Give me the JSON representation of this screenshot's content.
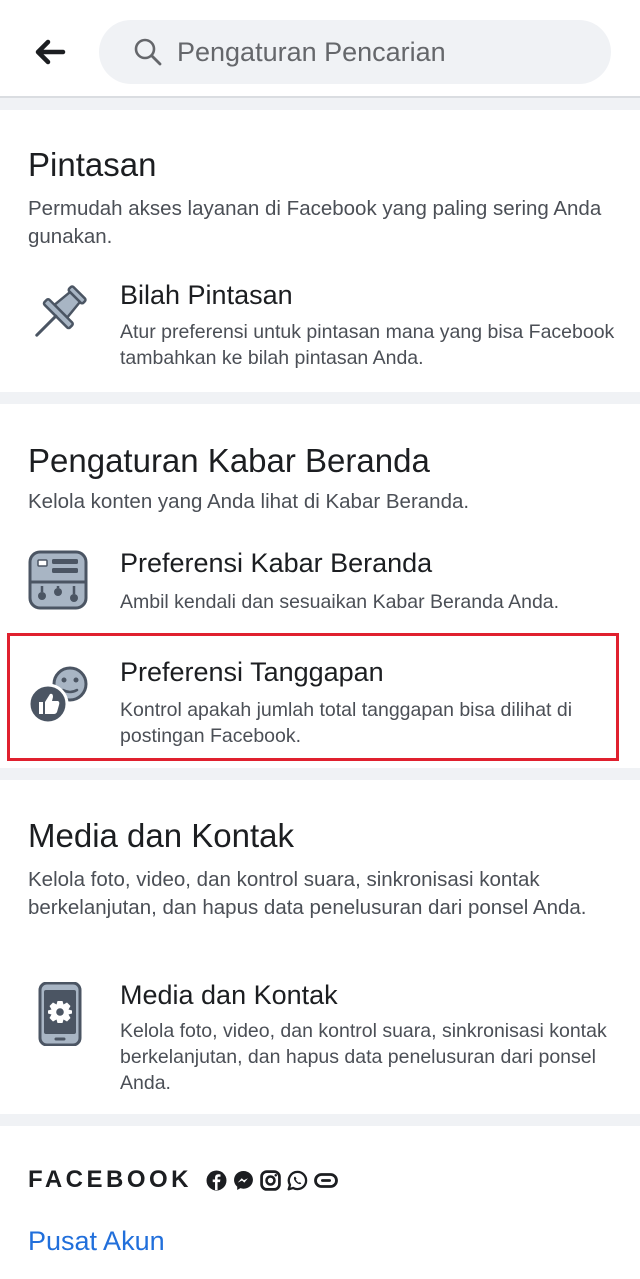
{
  "header": {
    "search_placeholder": "Pengaturan Pencarian",
    "back_icon": "arrow-left-icon",
    "search_icon": "magnifier-icon"
  },
  "sections": {
    "shortcuts": {
      "title": "Pintasan",
      "description": "Permudah akses layanan di Facebook yang paling sering Anda gunakan.",
      "items": [
        {
          "icon": "pushpin-icon",
          "title": "Bilah Pintasan",
          "description": "Atur preferensi untuk pintasan mana yang bisa Facebook tambahkan ke bilah pintasan Anda."
        }
      ]
    },
    "news_feed": {
      "title": "Pengaturan Kabar Beranda",
      "description": "Kelola konten yang Anda lihat di Kabar Beranda.",
      "items": [
        {
          "icon": "news-feed-preferences-icon",
          "title": "Preferensi Kabar Beranda",
          "description": "Ambil kendali dan sesuaikan Kabar Beranda Anda."
        },
        {
          "icon": "reactions-icon",
          "title": "Preferensi Tanggapan",
          "description": "Kontrol apakah jumlah total tanggapan bisa dilihat di postingan Facebook."
        }
      ]
    },
    "media": {
      "title": "Media dan Kontak",
      "description": "Kelola foto, video, dan kontrol suara, sinkronisasi kontak berkelanjutan, dan hapus data penelusuran dari ponsel Anda.",
      "items": [
        {
          "icon": "phone-gear-icon",
          "title": "Media dan Kontak",
          "description": "Kelola foto, video, dan kontrol suara, sinkronisasi kontak berkelanjutan, dan hapus data penelusuran dari ponsel Anda."
        }
      ]
    }
  },
  "footer": {
    "brand": "FACEBOOK",
    "brand_icons": [
      "facebook-icon",
      "messenger-icon",
      "instagram-icon",
      "whatsapp-icon",
      "portal-icon"
    ],
    "link": "Pusat Akun"
  },
  "colors": {
    "link": "#216fdb",
    "icon": "#4b5563",
    "highlight": "#e0202e",
    "divider": "#f0f2f5"
  }
}
